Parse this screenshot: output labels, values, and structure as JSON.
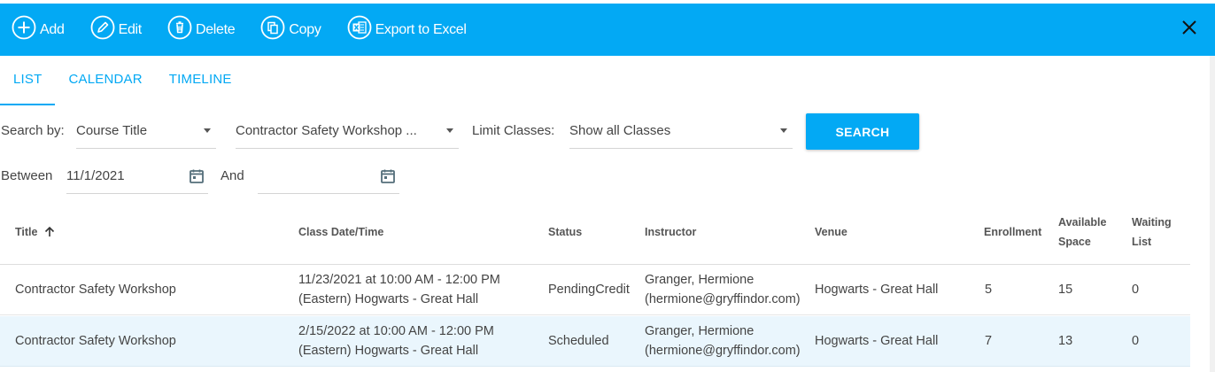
{
  "toolbar": {
    "add": "Add",
    "edit": "Edit",
    "delete": "Delete",
    "copy": "Copy",
    "export": "Export to Excel",
    "bg_color": "#03a9f4"
  },
  "tabs": [
    "LIST",
    "CALENDAR",
    "TIMELINE"
  ],
  "active_tab": "LIST",
  "filters": {
    "search_by_label": "Search by:",
    "search_by_value": "Course Title",
    "course_value": "Contractor Safety Workshop ...",
    "limit_label": "Limit Classes:",
    "limit_value": "Show all Classes",
    "search_button": "SEARCH",
    "between_label": "Between",
    "start_date": "11/1/2021",
    "and_label": "And",
    "end_date": ""
  },
  "table": {
    "columns": {
      "title": "Title",
      "date": "Class Date/Time",
      "status": "Status",
      "instructor": "Instructor",
      "venue": "Venue",
      "enrollment": "Enrollment",
      "available_1": "Available",
      "available_2": "Space",
      "waiting_1": "Waiting",
      "waiting_2": "List"
    },
    "rows": [
      {
        "title": "Contractor Safety Workshop",
        "date_line1": "11/23/2021 at 10:00 AM - 12:00 PM",
        "date_line2": "(Eastern) Hogwarts - Great Hall",
        "status": "PendingCredit",
        "instructor_line1": "Granger, Hermione",
        "instructor_line2": "(hermione@gryffindor.com)",
        "venue": "Hogwarts - Great Hall",
        "enrollment": "5",
        "available": "15",
        "waiting": "0"
      },
      {
        "title": "Contractor Safety Workshop",
        "date_line1": "2/15/2022 at 10:00 AM - 12:00 PM",
        "date_line2": "(Eastern) Hogwarts - Great Hall",
        "status": "Scheduled",
        "instructor_line1": "Granger, Hermione",
        "instructor_line2": "(hermione@gryffindor.com)",
        "venue": "Hogwarts - Great Hall",
        "enrollment": "7",
        "available": "13",
        "waiting": "0"
      }
    ]
  }
}
